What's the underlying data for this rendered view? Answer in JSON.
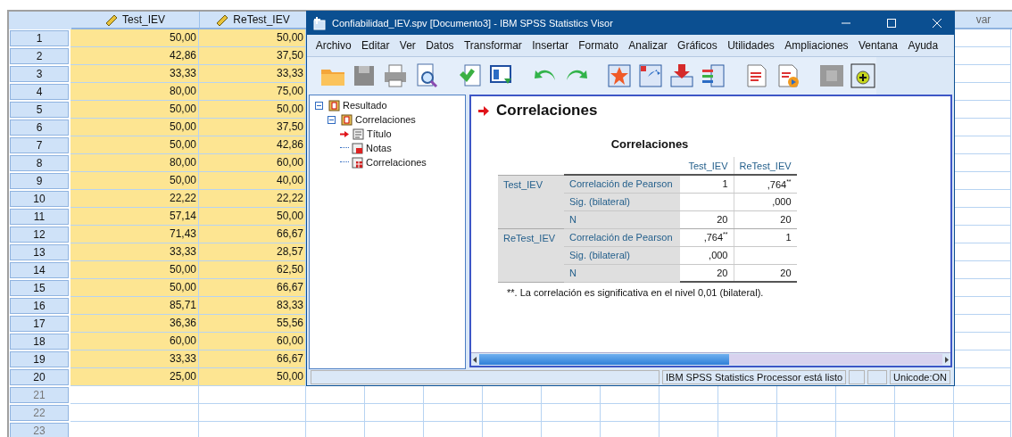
{
  "data_editor": {
    "columns": [
      {
        "name": "Test_IEV"
      },
      {
        "name": "ReTest_IEV"
      }
    ],
    "extra_column": "var",
    "rows": [
      {
        "number": "1",
        "values": [
          "50,00",
          "50,00"
        ]
      },
      {
        "number": "2",
        "values": [
          "42,86",
          "37,50"
        ]
      },
      {
        "number": "3",
        "values": [
          "33,33",
          "33,33"
        ]
      },
      {
        "number": "4",
        "values": [
          "80,00",
          "75,00"
        ]
      },
      {
        "number": "5",
        "values": [
          "50,00",
          "50,00"
        ]
      },
      {
        "number": "6",
        "values": [
          "50,00",
          "37,50"
        ]
      },
      {
        "number": "7",
        "values": [
          "50,00",
          "42,86"
        ]
      },
      {
        "number": "8",
        "values": [
          "80,00",
          "60,00"
        ]
      },
      {
        "number": "9",
        "values": [
          "50,00",
          "40,00"
        ]
      },
      {
        "number": "10",
        "values": [
          "22,22",
          "22,22"
        ]
      },
      {
        "number": "11",
        "values": [
          "57,14",
          "50,00"
        ]
      },
      {
        "number": "12",
        "values": [
          "71,43",
          "66,67"
        ]
      },
      {
        "number": "13",
        "values": [
          "33,33",
          "28,57"
        ]
      },
      {
        "number": "14",
        "values": [
          "50,00",
          "62,50"
        ]
      },
      {
        "number": "15",
        "values": [
          "50,00",
          "66,67"
        ]
      },
      {
        "number": "16",
        "values": [
          "85,71",
          "83,33"
        ]
      },
      {
        "number": "17",
        "values": [
          "36,36",
          "55,56"
        ]
      },
      {
        "number": "18",
        "values": [
          "60,00",
          "60,00"
        ]
      },
      {
        "number": "19",
        "values": [
          "33,33",
          "66,67"
        ]
      },
      {
        "number": "20",
        "values": [
          "25,00",
          "50,00"
        ]
      }
    ],
    "empty_rows": [
      "21",
      "22",
      "23"
    ]
  },
  "viewer": {
    "title": "Confiabilidad_IEV.spv [Documento3] - IBM SPSS Statistics Visor",
    "menu": [
      "Archivo",
      "Editar",
      "Ver",
      "Datos",
      "Transformar",
      "Insertar",
      "Formato",
      "Analizar",
      "Gráficos",
      "Utilidades",
      "Ampliaciones",
      "Ventana",
      "Ayuda"
    ],
    "outline": [
      {
        "label": "Resultado",
        "kind": "log",
        "expanded": true,
        "current": false,
        "children": [
          {
            "label": "Correlaciones",
            "kind": "log",
            "expanded": true,
            "current": false,
            "children": [
              {
                "label": "Título",
                "kind": "title",
                "current": true
              },
              {
                "label": "Notas",
                "kind": "notes",
                "current": false
              },
              {
                "label": "Correlaciones",
                "kind": "table",
                "current": false
              }
            ]
          }
        ]
      }
    ],
    "output": {
      "heading": "Correlaciones",
      "table_title": "Correlaciones",
      "columns": [
        "Test_IEV",
        "ReTest_IEV"
      ],
      "groups": [
        {
          "label": "Test_IEV",
          "rows": [
            {
              "stat": "Correlación de Pearson",
              "cells": [
                {
                  "text": "1"
                },
                {
                  "text": ",764$^{**}$"
                }
              ]
            },
            {
              "stat": "Sig. (bilateral)",
              "cells": [
                {
                  "blank": true
                },
                {
                  "text": ",000"
                }
              ]
            },
            {
              "stat": "N",
              "cells": [
                {
                  "text": "20"
                },
                {
                  "text": "20"
                }
              ]
            }
          ]
        },
        {
          "label": "ReTest_IEV",
          "rows": [
            {
              "stat": "Correlación de Pearson",
              "cells": [
                {
                  "text": ",764$^{**}$"
                },
                {
                  "text": "1"
                }
              ]
            },
            {
              "stat": "Sig. (bilateral)",
              "cells": [
                {
                  "text": ",000"
                },
                {
                  "blank": true
                }
              ]
            },
            {
              "stat": "N",
              "cells": [
                {
                  "text": "20"
                },
                {
                  "text": "20"
                }
              ]
            }
          ]
        }
      ],
      "footnote": "**. La correlación es significativa en el nivel 0,01 (bilateral)."
    },
    "status_bar": [
      "IBM SPSS Statistics Processor está listo",
      "Unicode:ON"
    ]
  }
}
